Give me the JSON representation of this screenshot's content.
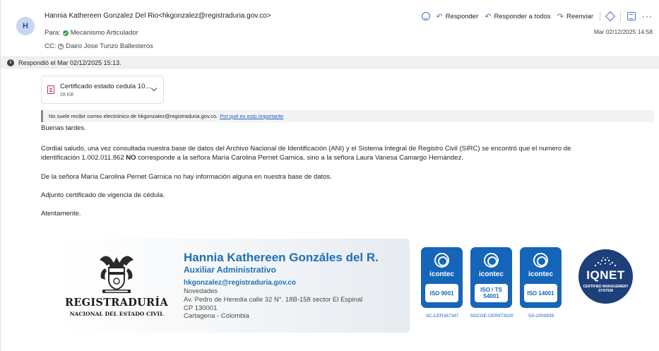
{
  "header": {
    "avatar_initial": "H",
    "from": "Hannia Kathereen Gonzalez Del Rio<hkgonzalez@registraduria.gov.co>",
    "to_label": "Para:",
    "to_name": "Mecanismo Articulador",
    "cc_label": "CC:",
    "cc_name": "Dairo Jose Turizo Ballesteros",
    "date": "Mar 02/12/2025 14:58",
    "actions": {
      "reply": "Responder",
      "reply_all": "Responder a todos",
      "forward": "Reenviar",
      "more": "···"
    }
  },
  "infobar": {
    "text": "Respondió el Mar 02/12/2025 15:13."
  },
  "attachment": {
    "name": "Certificado estado cedula 10...",
    "size": "28 KB",
    "icon": "pdf-file-icon"
  },
  "warning": {
    "text": "No suele recibir correo electrónico de hkgonzalez@registraduria.gov.co.",
    "link": "Por qué es esto importante"
  },
  "body": {
    "greeting": "Buenas tardes.",
    "p1_line1": "Cordial saludo, una vez consultada nuestra base de datos del Archivo Nacional de Identificación (ANI) y el Sistema Integral de Registro Civil (SIRC) se encontró que el numero de",
    "p1_line2_pre": "identificación 1.002.011.862 ",
    "p1_line2_bold": "NO",
    "p1_line2_post": " corresponde a la señora María Carolina Pernet Garnica, sino a la señora Laura Vanesa Camargo Hernández.",
    "p2": "De la señora María Carolina Pernet Garnica no hay información alguna en nuestra base de datos.",
    "p3": "Adjunto certificado de vigencia de cédula.",
    "closing": "Atentamente."
  },
  "signature": {
    "org_title": "REGISTRADURÍA",
    "org_subtitle": "NACIONAL DEL ESTADO CIVIL",
    "name": "Hannia Kathereen Gonzáles del R.",
    "role": "Auxiliar Administrativo",
    "email": "hkgonzalez@registraduria.gov.co",
    "line1": "Novedades",
    "line2": "Av. Pedro de Heredia calle 32 N°. 18B-158 sector El Espinal",
    "line3": "CP 130001",
    "line4": "Cartagena - Colombia"
  },
  "certifications": [
    {
      "brand": "icontec",
      "iso": "ISO 9001",
      "code": "SC-CER367347"
    },
    {
      "brand": "icontec",
      "iso": "ISO / TS 54001",
      "code": "SGCOE-CER973020"
    },
    {
      "brand": "icontec",
      "iso": "ISO 14001",
      "code": "SA-2000835"
    }
  ],
  "iqnet": {
    "brand": "IQNET",
    "tag": "CERTIFIED MANAGEMENT SYSTEM"
  },
  "colors": {
    "link": "#1f5fc8",
    "signature_blue": "#1f6fb5",
    "icontec_blue": "#1565b8",
    "iqnet_navy": "#1d3f7a"
  }
}
